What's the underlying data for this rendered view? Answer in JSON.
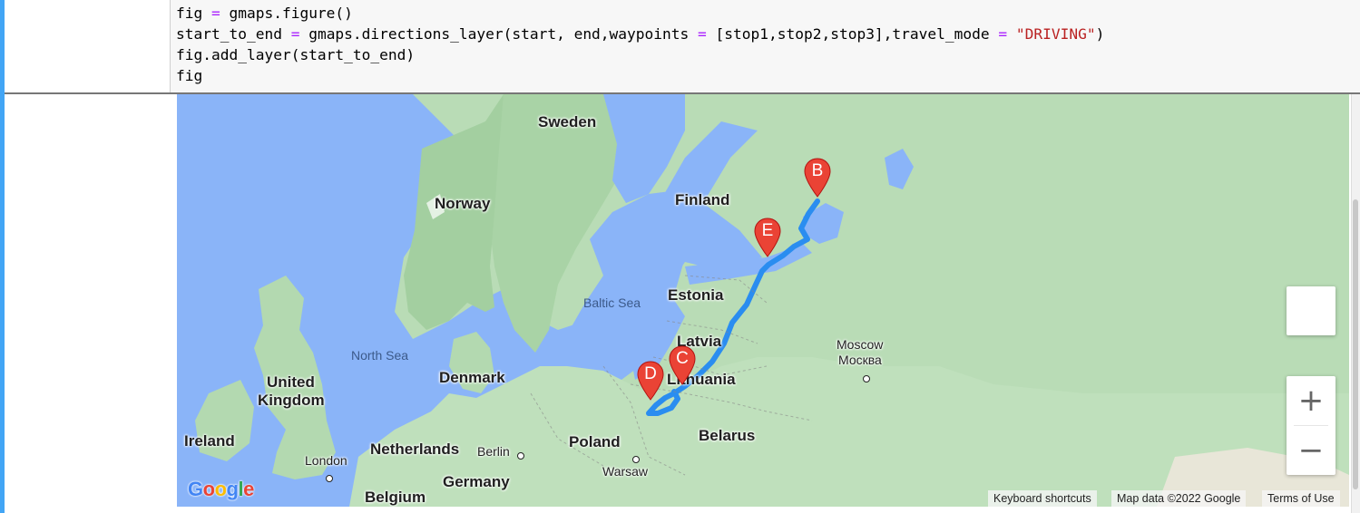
{
  "code_lines": [
    [
      {
        "t": "fig "
      },
      {
        "t": "=",
        "c": "kw-eq"
      },
      {
        "t": " gmaps.figure()"
      }
    ],
    [
      {
        "t": "start_to_end "
      },
      {
        "t": "=",
        "c": "kw-eq"
      },
      {
        "t": " gmaps.directions_layer(start, end,waypoints "
      },
      {
        "t": "=",
        "c": "kw-eq"
      },
      {
        "t": " [stop1,stop2,stop3],travel_mode "
      },
      {
        "t": "=",
        "c": "kw-eq"
      },
      {
        "t": " "
      },
      {
        "t": "\"DRIVING\"",
        "c": "str"
      },
      {
        "t": ")"
      }
    ],
    [
      {
        "t": "fig.add_layer(start_to_end)"
      }
    ],
    [
      {
        "t": "fig"
      }
    ]
  ],
  "map": {
    "labels": {
      "sweden": "Sweden",
      "norway": "Norway",
      "finland": "Finland",
      "estonia": "Estonia",
      "latvia": "Latvia",
      "lithuania": "Lithuania",
      "belarus": "Belarus",
      "poland": "Poland",
      "denmark": "Denmark",
      "netherlands": "Netherlands",
      "germany": "Germany",
      "belgium": "Belgium",
      "united_kingdom_1": "United",
      "united_kingdom_2": "Kingdom",
      "ireland": "Ireland",
      "baltic_sea": "Baltic Sea",
      "north_sea": "North Sea",
      "moscow": "Moscow",
      "moscow_cyr": "Москва",
      "london": "London",
      "berlin": "Berlin",
      "warsaw": "Warsaw"
    },
    "markers": [
      "B",
      "C",
      "D",
      "E"
    ],
    "route_color": "#2a8df0",
    "marker_color": "#ea4335",
    "google_logo": "Google",
    "attribution": {
      "shortcuts": "Keyboard shortcuts",
      "data": "Map data ©2022 Google",
      "terms": "Terms of Use"
    },
    "zoom_in": "+",
    "zoom_out": "−"
  }
}
